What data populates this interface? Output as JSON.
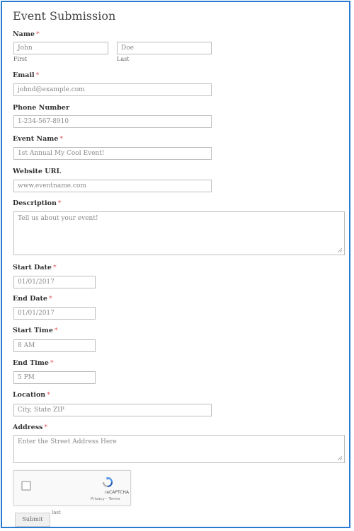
{
  "form": {
    "title": "Event Submission",
    "required_marker": "*",
    "name": {
      "label": "Name",
      "first_value": "John",
      "first_sublabel": "First",
      "last_value": "Doe",
      "last_sublabel": "Last"
    },
    "email": {
      "label": "Email",
      "value": "johnd@example.com"
    },
    "phone": {
      "label": "Phone Number",
      "value": "1-234-567-8910"
    },
    "event_name": {
      "label": "Event Name",
      "value": "1st Annual My Cool Event!"
    },
    "website": {
      "label": "Website URL",
      "value": "www.eventname.com"
    },
    "description": {
      "label": "Description",
      "placeholder": "Tell us about your event!"
    },
    "start_date": {
      "label": "Start Date",
      "value": "01/01/2017"
    },
    "end_date": {
      "label": "End Date",
      "value": "01/01/2017"
    },
    "start_time": {
      "label": "Start Time",
      "value": "8 AM"
    },
    "end_time": {
      "label": "End Time",
      "value": "5 PM"
    },
    "location": {
      "label": "Location",
      "value": "City, State ZIP"
    },
    "address": {
      "label": "Address",
      "placeholder": "Enter the Street Address Here"
    },
    "recaptcha": {
      "brand": "reCAPTCHA",
      "links": "Privacy - Terms"
    },
    "submit_label": "Submit",
    "stray_text": "last"
  },
  "colors": {
    "frame_border": "#2a7bd2",
    "required": "#e05a5a",
    "input_border": "#bdbdbd",
    "recaptcha_blue": "#4a90e2"
  }
}
